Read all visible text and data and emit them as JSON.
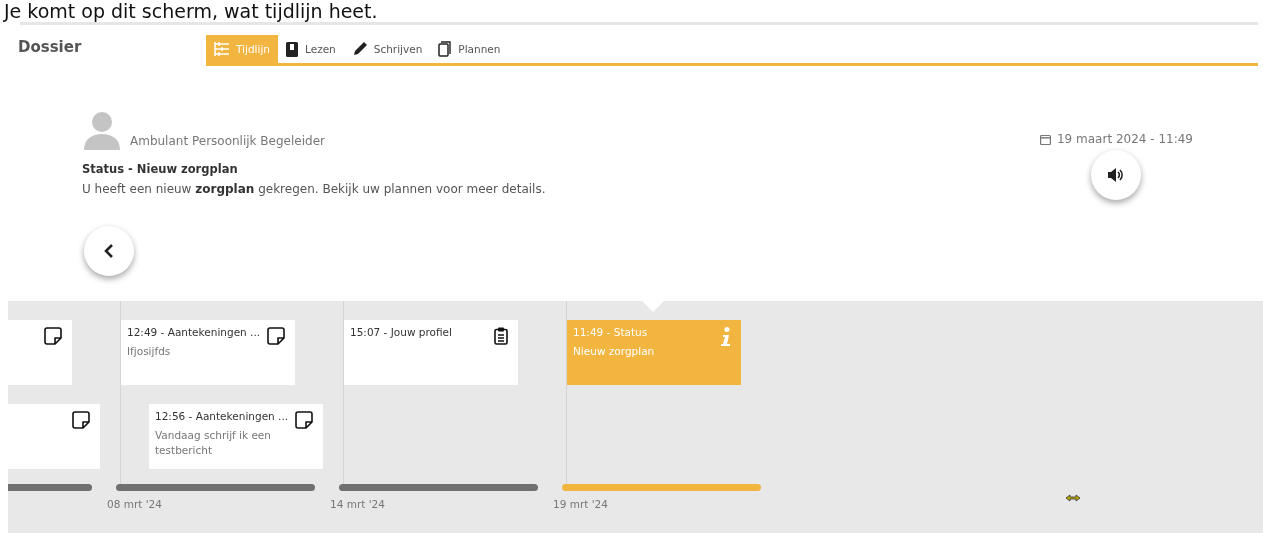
{
  "caption": "Je komt op dit scherm, wat tijdlijn heet.",
  "header": {
    "title": "Dossier"
  },
  "tabs": [
    {
      "label": "Tijdlijn",
      "kind": "timeline",
      "selected": true
    },
    {
      "label": "Lezen",
      "kind": "book",
      "selected": false
    },
    {
      "label": "Schrijven",
      "kind": "pencil",
      "selected": false
    },
    {
      "label": "Plannen",
      "kind": "page",
      "selected": false
    }
  ],
  "message": {
    "role": "Ambulant Persoonlijk Begeleider",
    "date": "19 maart 2024 - 11:49",
    "title": "Status - Nieuw zorgplan",
    "body": "U heeft een nieuw **zorgplan** gekregen. Bekijk uw plannen voor meer details."
  },
  "timeline": {
    "days": [
      {
        "selected": false,
        "items": [
          {
            "kind": "note",
            "selected": false
          },
          {
            "kind": "note",
            "selected": false
          }
        ]
      },
      {
        "date": "08 mrt '24",
        "selected": false,
        "items": [
          {
            "kind": "note",
            "title": "12:49 - Aantekeningen ...",
            "text": "Ifjosijfds",
            "selected": false
          },
          {
            "kind": "note",
            "title": "12:56 - Aantekeningen ...",
            "text": "Vandaag schrijf ik een testbericht",
            "selected": false
          }
        ]
      },
      {
        "date": "14 mrt '24",
        "selected": false,
        "items": [
          {
            "kind": "clipboard",
            "title": "15:07 - Jouw profiel",
            "selected": false
          }
        ]
      },
      {
        "date": "19 mrt '24",
        "selected": true,
        "items": [
          {
            "kind": "info",
            "title": "11:49 - Status",
            "text": "Nieuw zorgplan",
            "selected": true
          }
        ]
      }
    ]
  }
}
